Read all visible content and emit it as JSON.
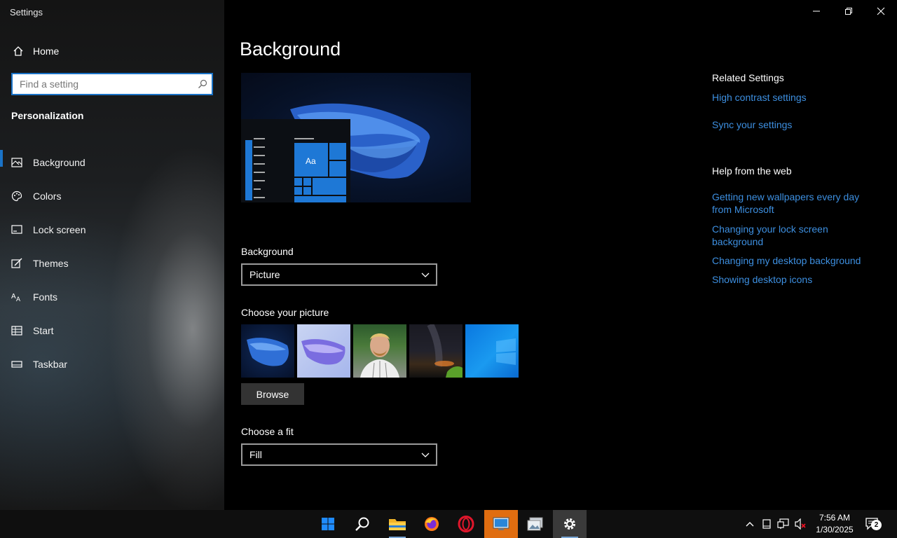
{
  "window": {
    "title": "Settings"
  },
  "sidebar": {
    "home_label": "Home",
    "search_placeholder": "Find a setting",
    "section_title": "Personalization",
    "items": [
      {
        "label": "Background",
        "icon": "picture-icon",
        "active": true
      },
      {
        "label": "Colors",
        "icon": "palette-icon",
        "active": false
      },
      {
        "label": "Lock screen",
        "icon": "lock-screen-icon",
        "active": false
      },
      {
        "label": "Themes",
        "icon": "themes-icon",
        "active": false
      },
      {
        "label": "Fonts",
        "icon": "fonts-icon",
        "active": false
      },
      {
        "label": "Start",
        "icon": "start-icon",
        "active": false
      },
      {
        "label": "Taskbar",
        "icon": "taskbar-icon",
        "active": false
      }
    ]
  },
  "main": {
    "page_title": "Background",
    "preview_tile_text": "Aa",
    "background_label": "Background",
    "background_value": "Picture",
    "choose_picture_label": "Choose your picture",
    "browse_label": "Browse",
    "choose_fit_label": "Choose a fit",
    "fit_value": "Fill"
  },
  "related": {
    "related_heading": "Related Settings",
    "related_links": [
      "High contrast settings",
      "Sync your settings"
    ],
    "help_heading": "Help from the web",
    "help_links": [
      "Getting new wallpapers every day from Microsoft",
      "Changing your lock screen background",
      "Changing my desktop background",
      "Showing desktop icons"
    ]
  },
  "taskbar": {
    "apps": [
      "windows-start",
      "search",
      "file-explorer",
      "firefox",
      "opera",
      "remote-desktop",
      "photos",
      "settings"
    ],
    "time": "7:56 AM",
    "date": "1/30/2025",
    "notification_count": "2"
  },
  "colors": {
    "accent": "#1a73c7",
    "link": "#3d8fe0"
  }
}
